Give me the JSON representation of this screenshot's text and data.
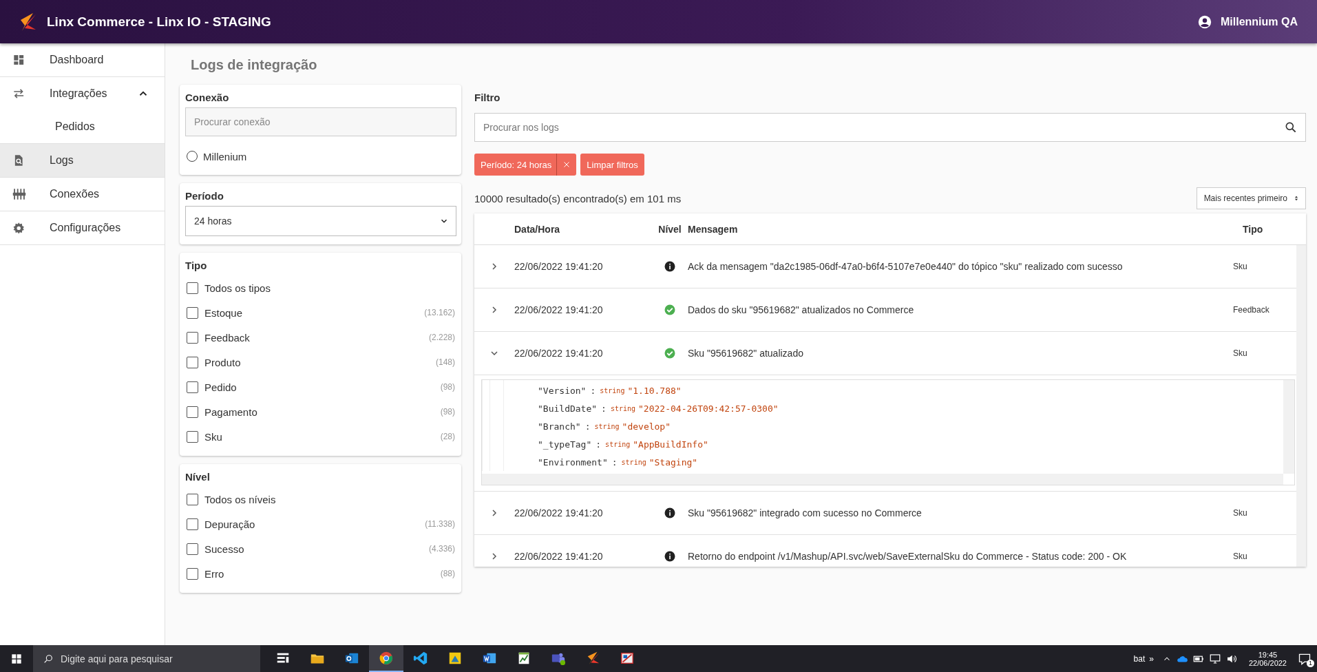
{
  "header": {
    "title": "Linx Commerce - Linx IO - STAGING",
    "user": "Millennium QA"
  },
  "sidebar": {
    "items": [
      {
        "label": "Dashboard",
        "selected": false
      },
      {
        "label": "Integrações",
        "selected": false,
        "expanded": true,
        "children": [
          {
            "label": "Pedidos",
            "selected": false
          }
        ]
      },
      {
        "label": "Logs",
        "selected": true
      },
      {
        "label": "Conexões",
        "selected": false
      },
      {
        "label": "Configurações",
        "selected": false
      }
    ]
  },
  "page_title": "Logs de integração",
  "connection": {
    "title": "Conexão",
    "placeholder": "Procurar conexão",
    "options": [
      {
        "label": "Millenium",
        "selected": false
      }
    ]
  },
  "period": {
    "title": "Período",
    "value": "24 horas"
  },
  "type_filter": {
    "title": "Tipo",
    "options": [
      {
        "label": "Todos os tipos",
        "checked": false
      },
      {
        "label": "Estoque",
        "count": "(13.162)",
        "checked": false
      },
      {
        "label": "Feedback",
        "count": "(2.228)",
        "checked": false
      },
      {
        "label": "Produto",
        "count": "(148)",
        "checked": false
      },
      {
        "label": "Pedido",
        "count": "(98)",
        "checked": false
      },
      {
        "label": "Pagamento",
        "count": "(98)",
        "checked": false
      },
      {
        "label": "Sku",
        "count": "(28)",
        "checked": false
      }
    ]
  },
  "level_filter": {
    "title": "Nível",
    "options": [
      {
        "label": "Todos os níveis",
        "checked": false
      },
      {
        "label": "Depuração",
        "count": "(11.338)",
        "checked": false
      },
      {
        "label": "Sucesso",
        "count": "(4.336)",
        "checked": false
      },
      {
        "label": "Erro",
        "count": "(88)",
        "checked": false
      }
    ]
  },
  "filter": {
    "title": "Filtro",
    "placeholder": "Procurar nos logs",
    "chips": [
      {
        "label": "Período: 24 horas",
        "removable": true
      }
    ],
    "clear_button": "Limpar filtros"
  },
  "results": "10000 resultado(s) encontrado(s) em 101 ms",
  "sort": "Mais recentes primeiro",
  "table": {
    "columns": [
      "Data/Hora",
      "Nível",
      "Mensagem",
      "Tipo"
    ],
    "rows": [
      {
        "datetime": "22/06/2022 19:41:20",
        "kind": "info",
        "message": "Ack da mensagem \"da2c1985-06df-47a0-b6f4-5107e7e0e440\" do tópico \"sku\" realizado com sucesso",
        "type": "Sku",
        "expanded": false
      },
      {
        "datetime": "22/06/2022 19:41:20",
        "kind": "success",
        "message": "Dados do sku \"95619682\" atualizados no Commerce",
        "type": "Feedback",
        "expanded": false
      },
      {
        "datetime": "22/06/2022 19:41:20",
        "kind": "success",
        "message": "Sku \"95619682\" atualizado",
        "type": "Sku",
        "expanded": true,
        "details": [
          {
            "key": "\"Version\"",
            "separator": ":",
            "value_type": "string",
            "value": "\"1.10.788\""
          },
          {
            "key": "\"BuildDate\"",
            "separator": ":",
            "value_type": "string",
            "value": "\"2022-04-26T09:42:57-0300\""
          },
          {
            "key": "\"Branch\"",
            "separator": ":",
            "value_type": "string",
            "value": "\"develop\""
          },
          {
            "key": "\"_typeTag\"",
            "separator": ":",
            "value_type": "string",
            "value": "\"AppBuildInfo\""
          },
          {
            "key": "\"Environment\"",
            "separator": ":",
            "value_type": "string",
            "value": "\"Staging\""
          }
        ]
      },
      {
        "datetime": "22/06/2022 19:41:20",
        "kind": "info",
        "message": "Sku \"95619682\" integrado com sucesso no Commerce",
        "type": "Sku",
        "expanded": false
      },
      {
        "datetime": "22/06/2022 19:41:20",
        "kind": "info",
        "message": "Retorno do endpoint /v1/Mashup/API.svc/web/SaveExternalSku do Commerce - Status code: 200 - OK",
        "type": "Sku",
        "expanded": false
      }
    ]
  },
  "taskbar": {
    "search_placeholder": "Digite aqui para pesquisar",
    "apps": [
      {
        "selected": false
      },
      {
        "selected": false
      },
      {
        "selected": false
      },
      {
        "selected": true
      },
      {
        "selected": false
      },
      {
        "selected": false
      },
      {
        "selected": false
      },
      {
        "selected": false
      },
      {
        "selected": false
      },
      {
        "selected": false
      },
      {
        "selected": false
      }
    ],
    "tray_label": "bat",
    "tray_chevron": "»",
    "time": "19:45",
    "date": "22/06/2022",
    "notifications": "1"
  }
}
